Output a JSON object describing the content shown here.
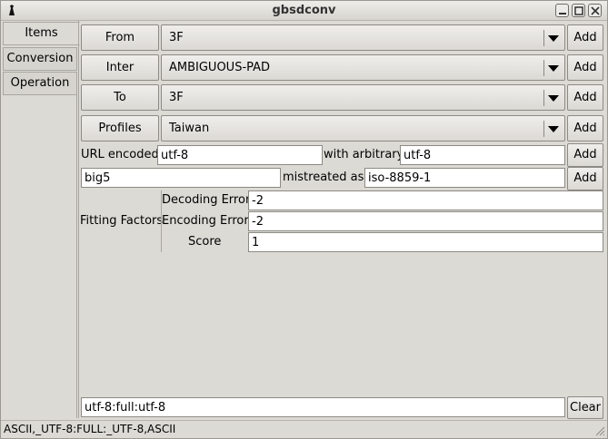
{
  "window": {
    "title": "gbsdconv"
  },
  "tabs": [
    {
      "label": "Items"
    },
    {
      "label": "Conversion"
    },
    {
      "label": "Operation"
    }
  ],
  "rows": {
    "from": {
      "label": "From",
      "value": "3F",
      "add": "Add"
    },
    "inter": {
      "label": "Inter",
      "value": "AMBIGUOUS-PAD",
      "add": "Add"
    },
    "to": {
      "label": "To",
      "value": "3F",
      "add": "Add"
    },
    "profiles": {
      "label": "Profiles",
      "value": "Taiwan",
      "add": "Add"
    }
  },
  "url_encoded": {
    "label": "URL encoded",
    "value": "utf-8",
    "mid_label": "with arbitrary",
    "value2": "utf-8",
    "add": "Add"
  },
  "mistreated": {
    "value": "big5",
    "mid_label": "mistreated as",
    "value2": "iso-8859-1",
    "add": "Add"
  },
  "fitting": {
    "label": "Fitting Factors",
    "decoding_label": "Decoding Error",
    "decoding_value": "-2",
    "encoding_label": "Encoding Error",
    "encoding_value": "-2",
    "score_label": "Score",
    "score_value": "1"
  },
  "command": {
    "value": "utf-8:full:utf-8",
    "clear": "Clear"
  },
  "status": {
    "text": "ASCII,_UTF-8:FULL:_UTF-8,ASCII"
  }
}
